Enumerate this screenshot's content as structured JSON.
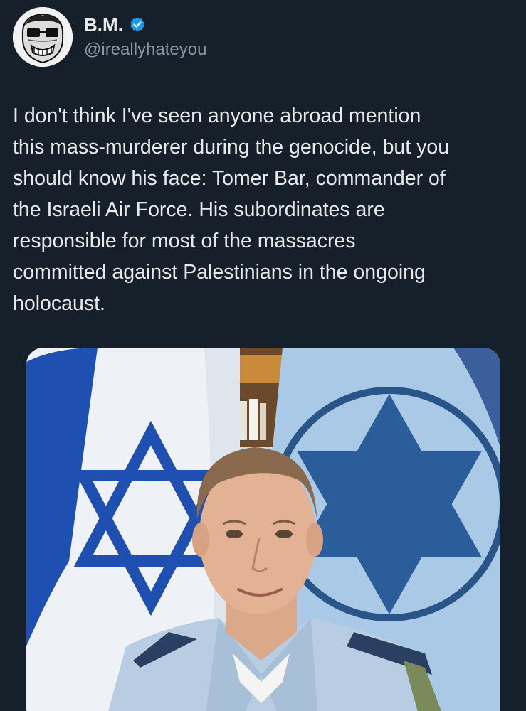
{
  "author": {
    "display_name": "B.M.",
    "handle": "@ireallyhateyou",
    "verified": true,
    "avatar": "avatar-image"
  },
  "tweet": {
    "text": "I don't think I've seen anyone abroad mention\nthis mass-murderer during the genocide, but you\nshould know his face: Tomer Bar, commander of\nthe Israeli Air Force. His subordinates are\nresponsible for most of the massacres\ncommitted against Palestinians in the ongoing\nholocaust."
  },
  "media": {
    "kind": "photo",
    "icon": "photo-image"
  },
  "colors": {
    "background": "#15202b",
    "text_primary": "#e7e9ea",
    "text_secondary": "#8b98a5",
    "verified_badge": "#1d9bf0"
  }
}
